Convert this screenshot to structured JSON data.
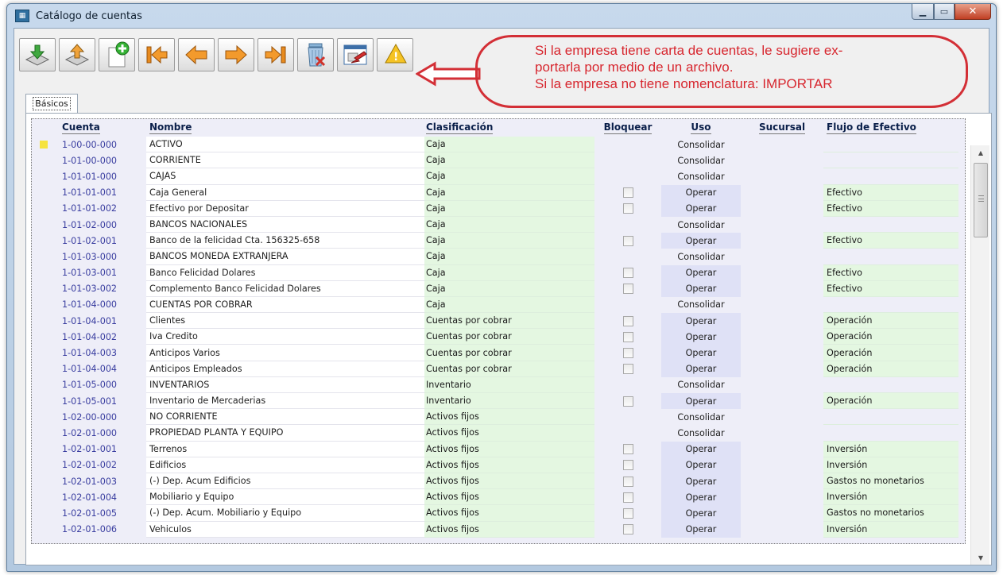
{
  "window": {
    "title": "Catálogo de cuentas"
  },
  "toolbar": {
    "buttons": [
      {
        "name": "import-down-button",
        "icon": "download-arrow-icon"
      },
      {
        "name": "export-up-button",
        "icon": "upload-arrow-icon"
      },
      {
        "name": "new-record-button",
        "icon": "new-document-icon"
      },
      {
        "name": "first-record-button",
        "icon": "first-arrow-icon"
      },
      {
        "name": "previous-record-button",
        "icon": "left-arrow-icon"
      },
      {
        "name": "next-record-button",
        "icon": "right-arrow-icon"
      },
      {
        "name": "last-record-button",
        "icon": "last-arrow-icon"
      },
      {
        "name": "delete-button",
        "icon": "trash-icon"
      },
      {
        "name": "import-window-button",
        "icon": "import-window-icon"
      },
      {
        "name": "help-button",
        "icon": "help-icon"
      }
    ]
  },
  "callout": {
    "line1": "Si la empresa tiene carta de cuentas, le sugiere ex-",
    "line2": "portarla por medio de un archivo.",
    "line3": "Si la empresa no tiene nomenclatura: IMPORTAR"
  },
  "tabs": [
    {
      "label": "Básicos"
    }
  ],
  "grid": {
    "headers": {
      "cuenta": "Cuenta",
      "nombre": "Nombre",
      "clasificacion": "Clasificación",
      "bloquear": "Bloquear",
      "uso": "Uso",
      "sucursal": "Sucursal",
      "flujo": "Flujo de Efectivo"
    },
    "rows": [
      {
        "cuenta": "1-00-00-000",
        "nombre": "ACTIVO",
        "clasificacion": "Caja",
        "uso": "Consolidar",
        "flujo": "",
        "checkbox": false
      },
      {
        "cuenta": "1-01-00-000",
        "nombre": "CORRIENTE",
        "clasificacion": "Caja",
        "uso": "Consolidar",
        "flujo": "",
        "checkbox": false
      },
      {
        "cuenta": "1-01-01-000",
        "nombre": "CAJAS",
        "clasificacion": "Caja",
        "uso": "Consolidar",
        "flujo": "",
        "checkbox": false
      },
      {
        "cuenta": "1-01-01-001",
        "nombre": "Caja General",
        "clasificacion": "Caja",
        "uso": "Operar",
        "flujo": "Efectivo",
        "checkbox": true
      },
      {
        "cuenta": "1-01-01-002",
        "nombre": "Efectivo por Depositar",
        "clasificacion": "Caja",
        "uso": "Operar",
        "flujo": "Efectivo",
        "checkbox": true
      },
      {
        "cuenta": "1-01-02-000",
        "nombre": "BANCOS NACIONALES",
        "clasificacion": "Caja",
        "uso": "Consolidar",
        "flujo": "",
        "checkbox": false
      },
      {
        "cuenta": "1-01-02-001",
        "nombre": "Banco de la felicidad Cta. 156325-658",
        "clasificacion": "Caja",
        "uso": "Operar",
        "flujo": "Efectivo",
        "checkbox": true
      },
      {
        "cuenta": "1-01-03-000",
        "nombre": "BANCOS MONEDA EXTRANJERA",
        "clasificacion": "Caja",
        "uso": "Consolidar",
        "flujo": "",
        "checkbox": false
      },
      {
        "cuenta": "1-01-03-001",
        "nombre": "Banco Felicidad Dolares",
        "clasificacion": "Caja",
        "uso": "Operar",
        "flujo": "Efectivo",
        "checkbox": true
      },
      {
        "cuenta": "1-01-03-002",
        "nombre": "Complemento Banco Felicidad Dolares",
        "clasificacion": "Caja",
        "uso": "Operar",
        "flujo": "Efectivo",
        "checkbox": true
      },
      {
        "cuenta": "1-01-04-000",
        "nombre": "CUENTAS POR COBRAR",
        "clasificacion": "Caja",
        "uso": "Consolidar",
        "flujo": "",
        "checkbox": false
      },
      {
        "cuenta": "1-01-04-001",
        "nombre": "Clientes",
        "clasificacion": "Cuentas por cobrar",
        "uso": "Operar",
        "flujo": "Operación",
        "checkbox": true
      },
      {
        "cuenta": "1-01-04-002",
        "nombre": "Iva Credito",
        "clasificacion": "Cuentas por cobrar",
        "uso": "Operar",
        "flujo": "Operación",
        "checkbox": true
      },
      {
        "cuenta": "1-01-04-003",
        "nombre": "Anticipos Varios",
        "clasificacion": "Cuentas por cobrar",
        "uso": "Operar",
        "flujo": "Operación",
        "checkbox": true
      },
      {
        "cuenta": "1-01-04-004",
        "nombre": "Anticipos Empleados",
        "clasificacion": "Cuentas por cobrar",
        "uso": "Operar",
        "flujo": "Operación",
        "checkbox": true
      },
      {
        "cuenta": "1-01-05-000",
        "nombre": "INVENTARIOS",
        "clasificacion": "Inventario",
        "uso": "Consolidar",
        "flujo": "",
        "checkbox": false
      },
      {
        "cuenta": "1-01-05-001",
        "nombre": "Inventario de Mercaderias",
        "clasificacion": "Inventario",
        "uso": "Operar",
        "flujo": "Operación",
        "checkbox": true
      },
      {
        "cuenta": "1-02-00-000",
        "nombre": "NO CORRIENTE",
        "clasificacion": "Activos fijos",
        "uso": "Consolidar",
        "flujo": "",
        "checkbox": false
      },
      {
        "cuenta": "1-02-01-000",
        "nombre": "PROPIEDAD PLANTA Y EQUIPO",
        "clasificacion": "Activos fijos",
        "uso": "Consolidar",
        "flujo": "",
        "checkbox": false
      },
      {
        "cuenta": "1-02-01-001",
        "nombre": "Terrenos",
        "clasificacion": "Activos fijos",
        "uso": "Operar",
        "flujo": "Inversión",
        "checkbox": true
      },
      {
        "cuenta": "1-02-01-002",
        "nombre": "Edificios",
        "clasificacion": "Activos fijos",
        "uso": "Operar",
        "flujo": "Inversión",
        "checkbox": true
      },
      {
        "cuenta": "1-02-01-003",
        "nombre": "(-) Dep. Acum Edificios",
        "clasificacion": "Activos fijos",
        "uso": "Operar",
        "flujo": "Gastos no monetarios",
        "checkbox": true
      },
      {
        "cuenta": "1-02-01-004",
        "nombre": "Mobiliario y Equipo",
        "clasificacion": "Activos fijos",
        "uso": "Operar",
        "flujo": "Inversión",
        "checkbox": true
      },
      {
        "cuenta": "1-02-01-005",
        "nombre": "(-) Dep. Acum. Mobiliario y Equipo",
        "clasificacion": "Activos fijos",
        "uso": "Operar",
        "flujo": "Gastos no monetarios",
        "checkbox": true
      },
      {
        "cuenta": "1-02-01-006",
        "nombre": "Vehiculos",
        "clasificacion": "Activos fijos",
        "uso": "Operar",
        "flujo": "Inversión",
        "checkbox": true
      }
    ]
  },
  "colors": {
    "callout": "#d32f36",
    "account_code": "#3a3ea0",
    "green_cell": "#e4f7e1",
    "row_marker": "#f6e33f"
  }
}
